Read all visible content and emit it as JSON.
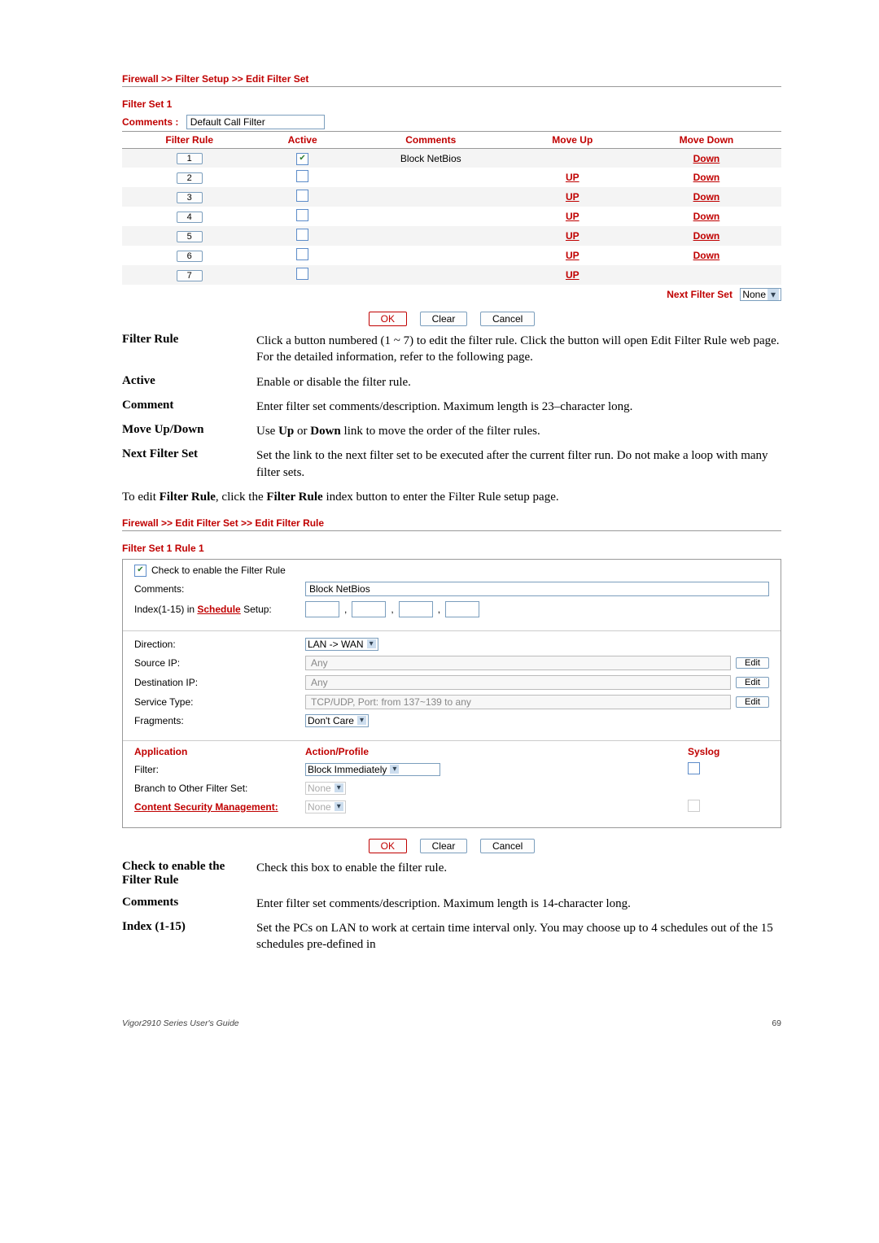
{
  "breadcrumb1": "Firewall >> Filter Setup >> Edit Filter Set",
  "filter_set_label": "Filter Set 1",
  "comments_label": "Comments :",
  "comments_value": "Default Call Filter",
  "table1": {
    "headers": {
      "filter_rule": "Filter Rule",
      "active": "Active",
      "comments": "Comments",
      "move_up": "Move Up",
      "move_down": "Move Down"
    },
    "rows": [
      {
        "n": "1",
        "active": true,
        "comment": "Block NetBios",
        "up": "",
        "down": "Down"
      },
      {
        "n": "2",
        "active": false,
        "comment": "",
        "up": "UP",
        "down": "Down"
      },
      {
        "n": "3",
        "active": false,
        "comment": "",
        "up": "UP",
        "down": "Down"
      },
      {
        "n": "4",
        "active": false,
        "comment": "",
        "up": "UP",
        "down": "Down"
      },
      {
        "n": "5",
        "active": false,
        "comment": "",
        "up": "UP",
        "down": "Down"
      },
      {
        "n": "6",
        "active": false,
        "comment": "",
        "up": "UP",
        "down": "Down"
      },
      {
        "n": "7",
        "active": false,
        "comment": "",
        "up": "UP",
        "down": ""
      }
    ],
    "next_filter_label": "Next Filter Set",
    "next_filter_value": "None"
  },
  "btns": {
    "ok": "OK",
    "clear": "Clear",
    "cancel": "Cancel"
  },
  "defs1": [
    {
      "term": "Filter Rule",
      "desc": "Click a button numbered (1 ~ 7) to edit the filter rule. Click the button will open Edit Filter Rule web page. For the detailed information, refer to the following page."
    },
    {
      "term": "Active",
      "desc": "Enable or disable the filter rule."
    },
    {
      "term": "Comment",
      "desc": "Enter filter set comments/description. Maximum length is 23–character long."
    },
    {
      "term": "Move Up/Down",
      "desc_html": "Use <b>Up</b> or <b>Down</b> link to move the order of the filter rules."
    },
    {
      "term": "Next Filter Set",
      "desc": "Set the link to the next filter set to be executed after the current filter run. Do not make a loop with many filter sets."
    }
  ],
  "body_text": "To edit <b>Filter Rule</b>, click the <b>Filter Rule</b> index button to enter the Filter Rule setup page.",
  "breadcrumb2": "Firewall >> Edit Filter Set >> Edit Filter Rule",
  "rule_box": {
    "title": "Filter Set 1 Rule 1",
    "enable_label": "Check to enable the Filter Rule",
    "comments_label": "Comments:",
    "comments_value": "Block NetBios",
    "index_label_pre": "Index(1-15) in ",
    "index_link": "Schedule",
    "index_label_post": " Setup:",
    "direction_label": "Direction:",
    "direction_value": "LAN -> WAN",
    "source_ip_label": "Source IP:",
    "source_ip_value": "Any",
    "dest_ip_label": "Destination IP:",
    "dest_ip_value": "Any",
    "service_label": "Service Type:",
    "service_value": "TCP/UDP, Port: from 137~139 to any",
    "fragments_label": "Fragments:",
    "fragments_value": "Don't Care",
    "edit_label": "Edit",
    "app_head": {
      "application": "Application",
      "action": "Action/Profile",
      "syslog": "Syslog"
    },
    "filter_label": "Filter:",
    "filter_value": "Block Immediately",
    "branch_label": "Branch to Other Filter Set:",
    "branch_value": "None",
    "csm_label": "Content Security Management:",
    "csm_value": "None"
  },
  "defs2": [
    {
      "term": "Check to enable the Filter Rule",
      "desc": "Check this box to enable the filter rule."
    },
    {
      "term": "Comments",
      "desc": "Enter filter set comments/description. Maximum length is 14-character long."
    },
    {
      "term": "Index (1-15)",
      "desc": "Set the PCs on LAN to work at certain time interval only. You may choose up to 4 schedules out of the 15 schedules pre-defined in"
    }
  ],
  "footer_left": "Vigor2910 Series User's Guide",
  "footer_right": "69"
}
